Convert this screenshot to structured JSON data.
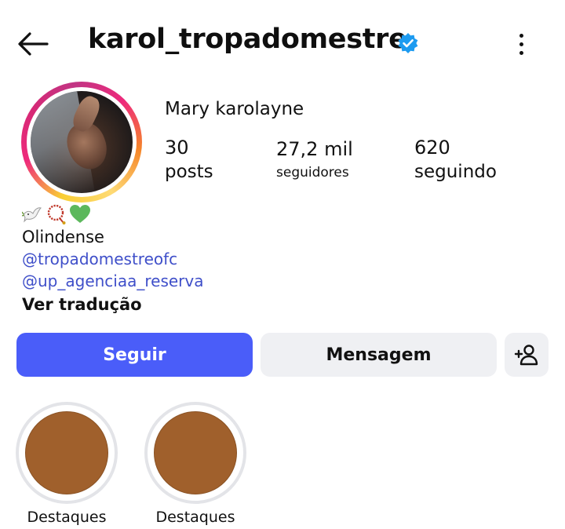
{
  "header": {
    "username": "karol_tropadomestre",
    "back_icon": "arrow-left-icon",
    "verified_icon": "verified-badge-icon",
    "more_icon": "more-vertical-icon"
  },
  "profile": {
    "display_name": "Mary karolayne",
    "stats": {
      "posts_count": "30",
      "posts_label": "posts",
      "followers_count": "27,2 mil",
      "followers_label": "seguidores",
      "following_count": "620",
      "following_label": "seguindo"
    },
    "bio": {
      "emojis": [
        "dove-emoji",
        "prayer-beads-emoji",
        "green-heart-emoji"
      ],
      "line": "Olindense",
      "links": [
        "@tropadomestreofc",
        "@up_agenciaa_reserva"
      ],
      "translate": "Ver tradução"
    }
  },
  "actions": {
    "follow_label": "Seguir",
    "message_label": "Mensagem",
    "suggest_icon": "add-person-icon"
  },
  "highlights": [
    {
      "label": "Destaques"
    },
    {
      "label": "Destaques"
    }
  ],
  "colors": {
    "accent": "#4a5df9",
    "link": "#3f4fc9",
    "verified": "#1d9bf0",
    "secondary_button": "#eff0f3",
    "highlight_cover": "#a0602c"
  }
}
